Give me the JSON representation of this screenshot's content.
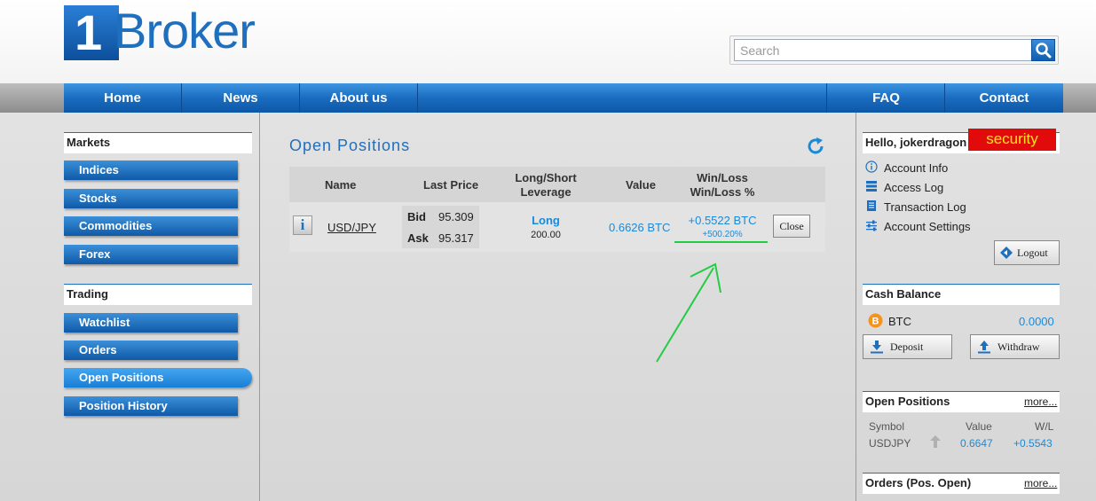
{
  "logo": {
    "one": "1",
    "word": "Broker"
  },
  "search": {
    "placeholder": "Search"
  },
  "nav": {
    "home": "Home",
    "news": "News",
    "about": "About us",
    "faq": "FAQ",
    "contact": "Contact"
  },
  "sidebar": {
    "markets_title": "Markets",
    "markets": [
      "Indices",
      "Stocks",
      "Commodities",
      "Forex"
    ],
    "trading_title": "Trading",
    "trading": [
      "Watchlist",
      "Orders",
      "Open Positions",
      "Position History"
    ],
    "active_item": "Open Positions"
  },
  "main": {
    "title": "Open Positions",
    "headers": {
      "name": "Name",
      "last_price": "Last Price",
      "long_short_1": "Long/Short",
      "long_short_2": "Leverage",
      "value": "Value",
      "winloss_1": "Win/Loss",
      "winloss_2": "Win/Loss %"
    },
    "row": {
      "info": "i",
      "symbol": "USD/JPY",
      "bid_label": "Bid",
      "bid": "95.309",
      "ask_label": "Ask",
      "ask": "95.317",
      "direction": "Long",
      "leverage": "200.00",
      "value": "0.6626 BTC",
      "winloss": "+0.5522 BTC",
      "winloss_pct": "+500.20%",
      "close_label": "Close"
    }
  },
  "right": {
    "greeting": "Hello, jokerdragon",
    "security_badge": "security",
    "links": [
      "Account Info",
      "Access Log",
      "Transaction Log",
      "Account Settings"
    ],
    "logout_label": "Logout",
    "cash_title": "Cash Balance",
    "cash_currency": "BTC",
    "cash_value": "0.0000",
    "deposit_label": "Deposit",
    "withdraw_label": "Withdraw",
    "open_title": "Open Positions",
    "more_label": "more...",
    "open_headers": {
      "symbol": "Symbol",
      "value": "Value",
      "wl": "W/L"
    },
    "open_row": {
      "symbol": "USDJPY",
      "value": "0.6647",
      "wl": "+0.5543"
    },
    "orders_title": "Orders (Pos. Open)"
  },
  "colors": {
    "brand_blue": "#1f6fbf",
    "value_blue": "#1a8ad8",
    "annotation_green": "#22cc44",
    "security_red": "#e10b0b"
  }
}
